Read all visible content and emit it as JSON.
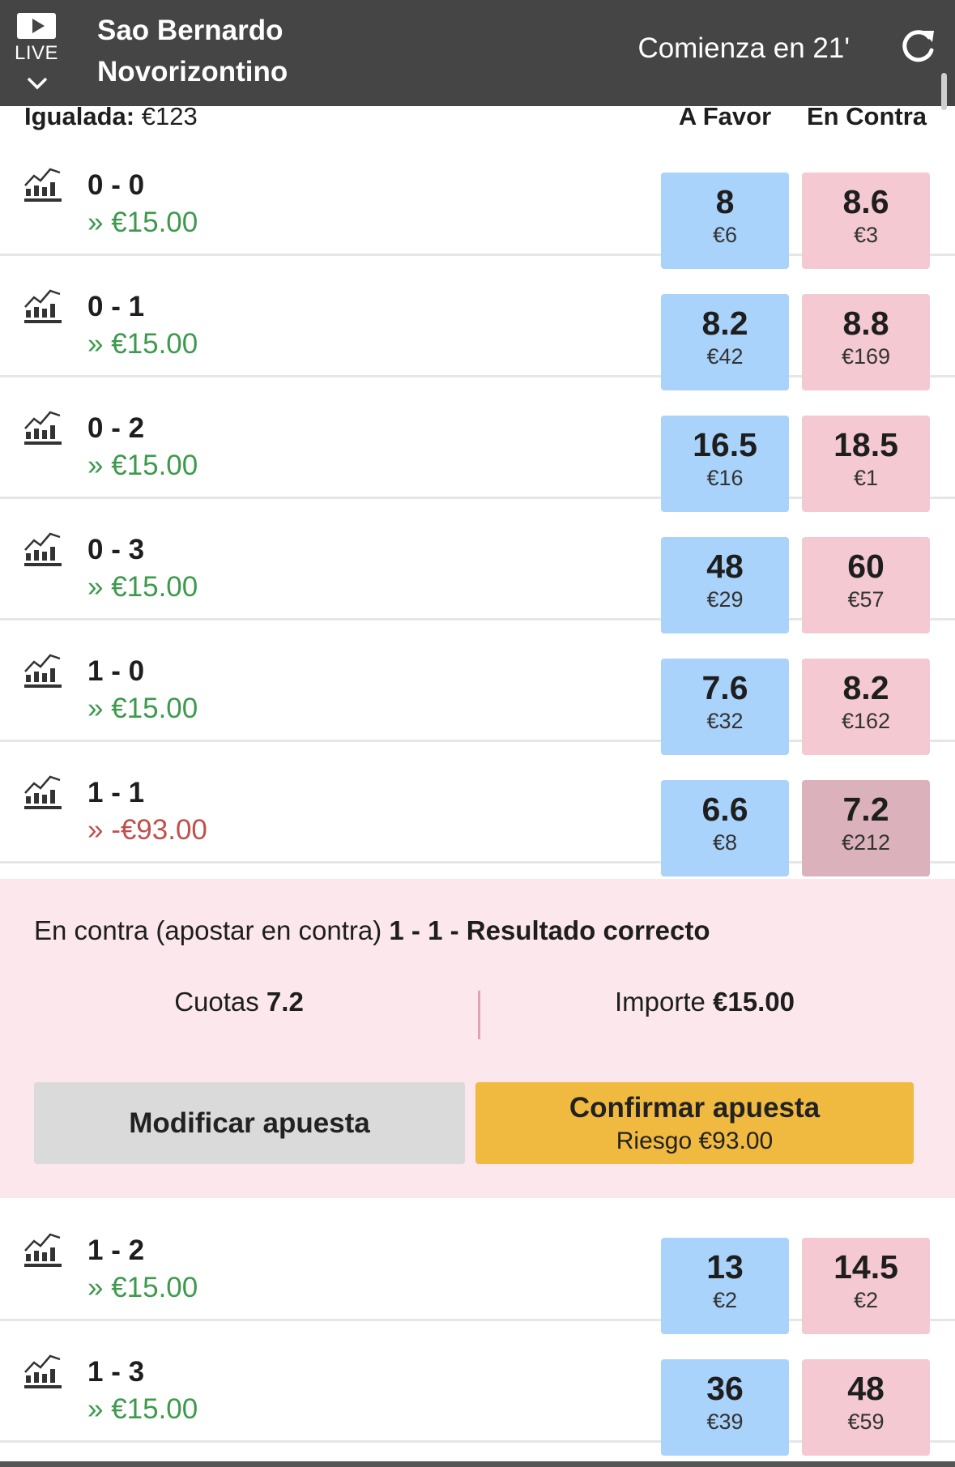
{
  "header": {
    "live_label": "LIVE",
    "team_home": "Sao Bernardo",
    "team_away": "Novorizontino",
    "starts_in": "Comienza en 21'"
  },
  "columns": {
    "matched_label": "Igualada:",
    "matched_value": "€123",
    "back_header": "A Favor",
    "lay_header": "En Contra"
  },
  "rows": [
    {
      "score": "0 - 0",
      "pl": "» €15.00",
      "back_price": "8",
      "back_size": "€6",
      "lay_price": "8.6",
      "lay_size": "€3"
    },
    {
      "score": "0 - 1",
      "pl": "» €15.00",
      "back_price": "8.2",
      "back_size": "€42",
      "lay_price": "8.8",
      "lay_size": "€169"
    },
    {
      "score": "0 - 2",
      "pl": "» €15.00",
      "back_price": "16.5",
      "back_size": "€16",
      "lay_price": "18.5",
      "lay_size": "€1"
    },
    {
      "score": "0 - 3",
      "pl": "» €15.00",
      "back_price": "48",
      "back_size": "€29",
      "lay_price": "60",
      "lay_size": "€57"
    },
    {
      "score": "1 - 0",
      "pl": "» €15.00",
      "back_price": "7.6",
      "back_size": "€32",
      "lay_price": "8.2",
      "lay_size": "€162"
    },
    {
      "score": "1 - 1",
      "pl": "» -€93.00",
      "back_price": "6.6",
      "back_size": "€8",
      "lay_price": "7.2",
      "lay_size": "€212"
    },
    {
      "score": "1 - 2",
      "pl": "» €15.00",
      "back_price": "13",
      "back_size": "€2",
      "lay_price": "14.5",
      "lay_size": "€2"
    },
    {
      "score": "1 - 3",
      "pl": "» €15.00",
      "back_price": "36",
      "back_size": "€39",
      "lay_price": "48",
      "lay_size": "€59"
    }
  ],
  "betslip": {
    "type_label": "En contra (apostar en contra)",
    "selection": "1 - 1 - Resultado correcto",
    "odds_label": "Cuotas",
    "odds_value": "7.2",
    "amount_label": "Importe",
    "amount_value": "€15.00",
    "modify_label": "Modificar apuesta",
    "confirm_label": "Confirmar apuesta",
    "risk_label": "Riesgo €93.00"
  },
  "colors": {
    "header_bg": "#454545",
    "back": "#a9d3fb",
    "lay": "#f4c9d2",
    "lay_selected": "#dbb2bb",
    "profit": "#3d9a4d",
    "loss": "#c0504d",
    "confirm": "#f0b93f"
  },
  "icons": [
    "play-icon",
    "chevron-down-icon",
    "refresh-icon",
    "chart-icon"
  ]
}
